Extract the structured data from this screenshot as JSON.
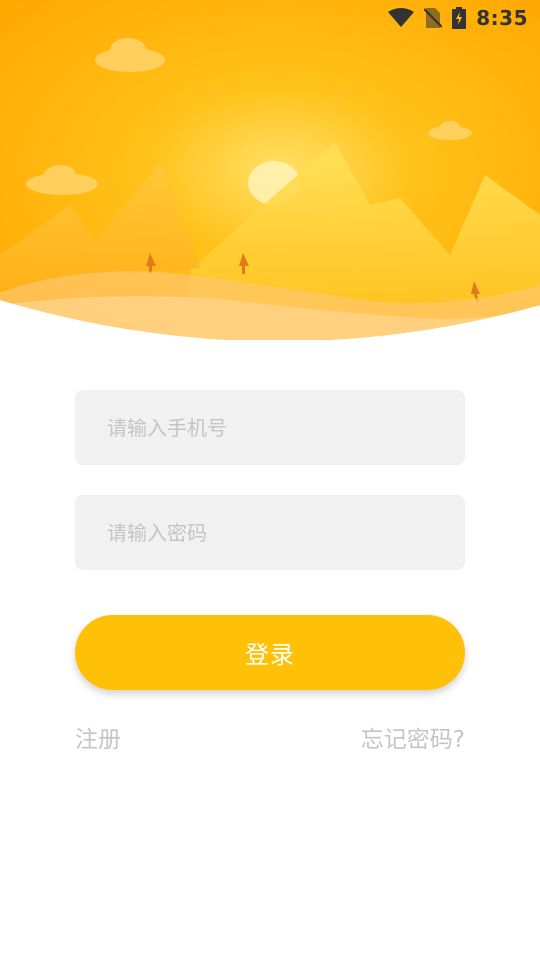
{
  "status_bar": {
    "time": "8:35",
    "icons": [
      "wifi-icon",
      "no-sim-icon",
      "battery-charging-icon"
    ]
  },
  "hero": {
    "illustration": "mountains-sunrise-illustration",
    "colors": {
      "sky_top": "#ffb300",
      "sky_glow": "#ffdd55",
      "mountain_front": "#ffb11a",
      "cloud": "#ffd36a",
      "tree": "#e07b1a"
    }
  },
  "form": {
    "phone_placeholder": "请输入手机号",
    "phone_value": "",
    "password_placeholder": "请输入密码",
    "password_value": "",
    "login_label": "登录"
  },
  "links": {
    "register_label": "注册",
    "forgot_password_label": "忘记密码?"
  },
  "colors": {
    "accent": "#ffc107",
    "field_background": "#f1f1f1",
    "placeholder_text": "#c4c4c4"
  }
}
